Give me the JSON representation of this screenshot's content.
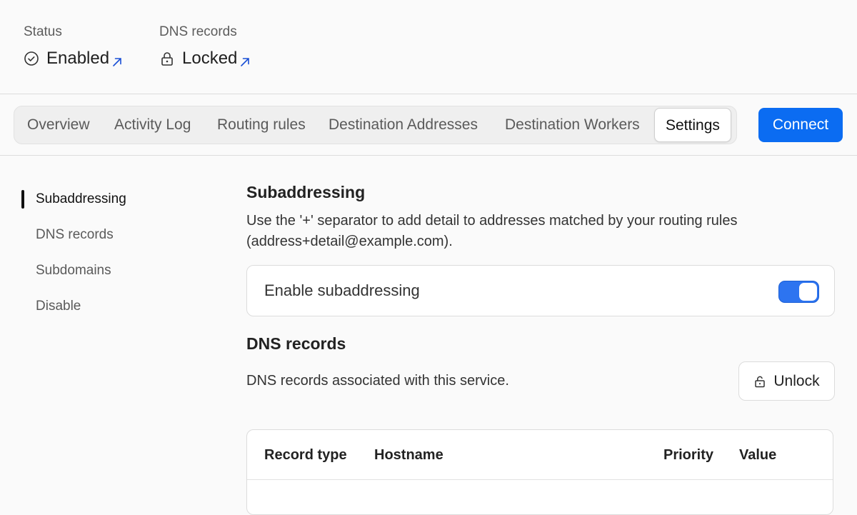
{
  "status": {
    "label": "Status",
    "value": "Enabled",
    "icon": "check-circle-icon",
    "link_icon": "external-link-icon"
  },
  "dns_status": {
    "label": "DNS records",
    "value": "Locked",
    "icon": "lock-icon",
    "link_icon": "external-link-icon"
  },
  "tabs": [
    {
      "label": "Overview"
    },
    {
      "label": "Activity Log"
    },
    {
      "label": "Routing rules"
    },
    {
      "label": "Destination Addresses"
    },
    {
      "label": "Destination Workers"
    },
    {
      "label": "Settings",
      "active": true
    }
  ],
  "connect_label": "Connect",
  "sidenav": [
    {
      "label": "Subaddressing",
      "active": true
    },
    {
      "label": "DNS records"
    },
    {
      "label": "Subdomains"
    },
    {
      "label": "Disable"
    }
  ],
  "subaddressing": {
    "title": "Subaddressing",
    "description": "Use the '+' separator to add detail to addresses matched by your routing rules (address+detail@example.com).",
    "toggle_label": "Enable subaddressing",
    "toggle_on": true
  },
  "dns_records": {
    "title": "DNS records",
    "description": "DNS records associated with this service.",
    "unlock_label": "Unlock",
    "unlock_icon": "unlock-icon",
    "columns": [
      "Record type",
      "Hostname",
      "Priority",
      "Value"
    ]
  },
  "colors": {
    "accent": "#0b6cf2",
    "toggle_on": "#2d74f0",
    "link": "#1a4fd6"
  }
}
